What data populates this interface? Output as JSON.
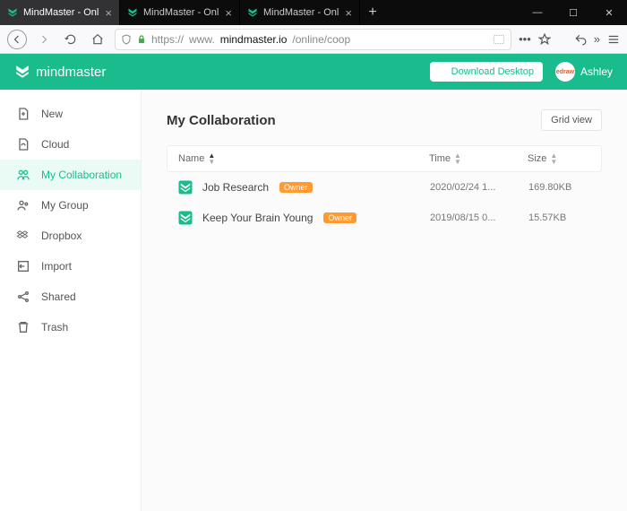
{
  "browser": {
    "tabs": [
      {
        "title": "MindMaster - Online Mind M",
        "active": true
      },
      {
        "title": "MindMaster - Online Mind M",
        "active": false
      },
      {
        "title": "MindMaster - Online Mind M",
        "active": false
      }
    ],
    "url_protocol": "https://",
    "url_prefix": "www.",
    "url_domain": "mindmaster.io",
    "url_path": "/online/coop"
  },
  "header": {
    "brand": "mindmaster",
    "download_label": "Download Desktop",
    "username": "Ashley",
    "avatar_text": "edraw"
  },
  "sidebar": {
    "items": [
      {
        "label": "New"
      },
      {
        "label": "Cloud"
      },
      {
        "label": "My Collaboration",
        "active": true
      },
      {
        "label": "My Group"
      },
      {
        "label": "Dropbox"
      },
      {
        "label": "Import"
      },
      {
        "label": "Shared"
      },
      {
        "label": "Trash"
      }
    ]
  },
  "main": {
    "title": "My Collaboration",
    "grid_view_label": "Grid view",
    "columns": {
      "name": "Name",
      "time": "Time",
      "size": "Size"
    },
    "rows": [
      {
        "name": "Job Research",
        "badge": "Owner",
        "time": "2020/02/24 1...",
        "size": "169.80KB"
      },
      {
        "name": "Keep Your Brain Young",
        "badge": "Owner",
        "time": "2019/08/15 0...",
        "size": "15.57KB"
      }
    ]
  }
}
